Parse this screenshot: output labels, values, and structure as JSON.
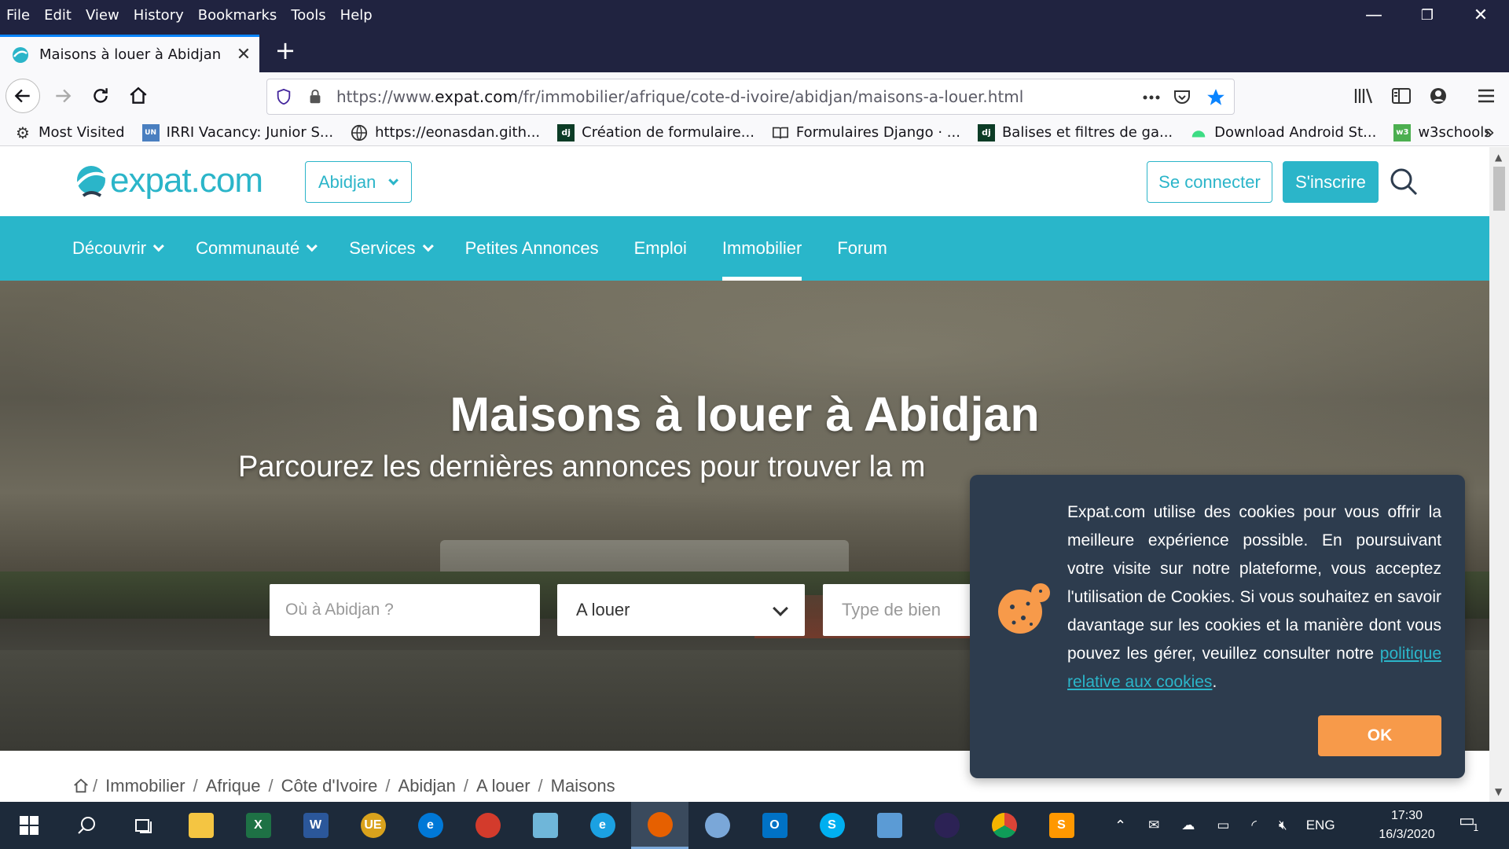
{
  "menubar": {
    "items": [
      "File",
      "Edit",
      "View",
      "History",
      "Bookmarks",
      "Tools",
      "Help"
    ]
  },
  "window_controls": {
    "minimize": "—",
    "restore": "❐",
    "close": "✕"
  },
  "tab": {
    "title": "Maisons à louer à Abidjan",
    "close": "✕"
  },
  "newtab": "+",
  "url": {
    "prefix": "https://www.",
    "domain": "expat.com",
    "path": "/fr/immobilier/afrique/cote-d-ivoire/abidjan/maisons-a-louer.html"
  },
  "bookmarks": [
    {
      "label": "Most Visited",
      "icon": "gear-icon"
    },
    {
      "label": "IRRI Vacancy: Junior S...",
      "icon": "un-jobs-icon"
    },
    {
      "label": "https://eonasdan.gith...",
      "icon": "globe-icon"
    },
    {
      "label": "Création de formulaire...",
      "icon": "django-icon"
    },
    {
      "label": "Formulaires Django · ...",
      "icon": "book-icon"
    },
    {
      "label": "Balises et filtres de ga...",
      "icon": "django-icon"
    },
    {
      "label": "Download Android St...",
      "icon": "android-icon"
    },
    {
      "label": "w3schools",
      "icon": "w3schools-icon"
    }
  ],
  "site": {
    "logo": "expat.com",
    "city": "Abidjan",
    "login": "Se connecter",
    "signup": "S'inscrire",
    "nav": [
      {
        "label": "Découvrir",
        "dropdown": true
      },
      {
        "label": "Communauté",
        "dropdown": true
      },
      {
        "label": "Services",
        "dropdown": true
      },
      {
        "label": "Petites Annonces",
        "dropdown": false
      },
      {
        "label": "Emploi",
        "dropdown": false
      },
      {
        "label": "Immobilier",
        "dropdown": false,
        "active": true
      },
      {
        "label": "Forum",
        "dropdown": false
      }
    ]
  },
  "hero": {
    "title": "Maisons à louer à Abidjan",
    "subtitle": "Parcourez les dernières annonces pour trouver la m",
    "where_placeholder": "Où à Abidjan ?",
    "mode_value": "A louer",
    "type_placeholder": "Type de bien"
  },
  "breadcrumb": [
    "Immobilier",
    "Afrique",
    "Côte d'Ivoire",
    "Abidjan",
    "A louer",
    "Maisons"
  ],
  "cookie": {
    "text": "Expat.com utilise des cookies pour vous offrir la meilleure expérience possible. En poursuivant votre visite sur notre plateforme, vous acceptez l'utilisation de Cookies. Si vous souhaitez en savoir davantage sur les cookies et la manière dont vous pouvez les gérer, veuillez consulter notre ",
    "link": "politique relative aux cookies",
    "end": ".",
    "ok": "OK"
  },
  "taskbar": {
    "language": "ENG",
    "time": "17:30",
    "date": "16/3/2020",
    "notification_count": "1"
  },
  "colors": {
    "brand": "#2bb5c9",
    "cookie_bg": "#2d3c4e",
    "ok": "#f79a4a",
    "titlebar": "#202340"
  }
}
